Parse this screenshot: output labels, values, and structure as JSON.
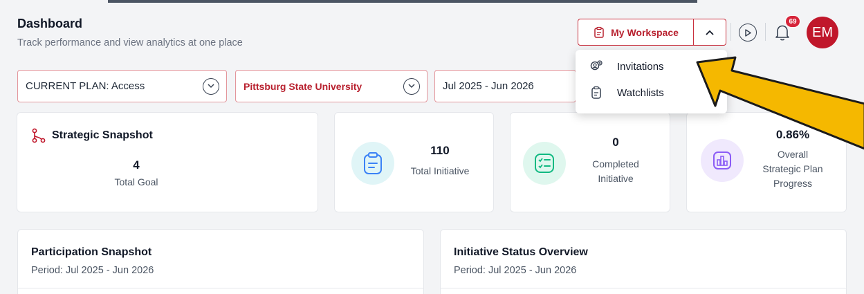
{
  "header": {
    "title": "Dashboard",
    "subtitle": "Track performance and view analytics at one place"
  },
  "workspace": {
    "label": "My Workspace",
    "menu": [
      {
        "label": "Invitations",
        "icon": "invitations-icon"
      },
      {
        "label": "Watchlists",
        "icon": "watchlist-icon"
      }
    ]
  },
  "notifications": {
    "count": "69"
  },
  "user": {
    "initials": "EM"
  },
  "filters": {
    "plan": "CURRENT PLAN: Access",
    "university": "Pittsburg State University",
    "period": "Jul 2025 - Jun 2026"
  },
  "stats": {
    "snapshot": {
      "title": "Strategic Snapshot",
      "value": "4",
      "label": "Total Goal"
    },
    "total_initiative": {
      "value": "110",
      "label": "Total Initiative"
    },
    "completed": {
      "value": "0",
      "label1": "Completed",
      "label2": "Initiative"
    },
    "progress": {
      "value": "0.86%",
      "label1": "Overall",
      "label2": "Strategic Plan",
      "label3": "Progress"
    }
  },
  "panels": {
    "participation": {
      "title": "Participation Snapshot",
      "period": "Period: Jul 2025 - Jun 2026"
    },
    "initiative_status": {
      "title": "Initiative Status Overview",
      "period": "Period: Jul 2025 - Jun 2026"
    }
  },
  "colors": {
    "brand": "#c0172b",
    "accent_arrow": "#f5b800"
  }
}
